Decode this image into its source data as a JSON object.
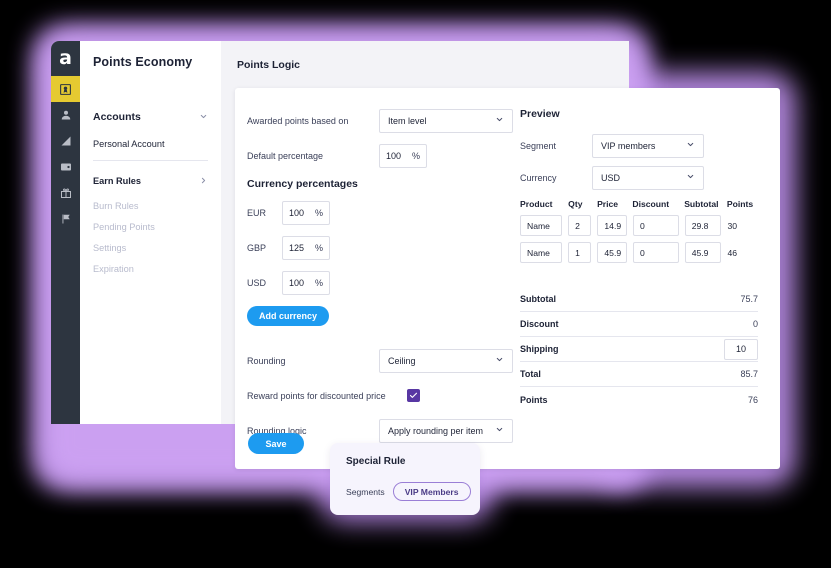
{
  "app": {
    "logo_letter": "a",
    "brand": "Points Economy"
  },
  "rail": {
    "items": [
      {
        "name": "award-badge-icon",
        "active": true
      },
      {
        "name": "user-icon",
        "active": false
      },
      {
        "name": "chart-icon",
        "active": false
      },
      {
        "name": "wallet-icon",
        "active": false
      },
      {
        "name": "gift-icon",
        "active": false
      },
      {
        "name": "flag-icon",
        "active": false
      }
    ]
  },
  "sidebar": {
    "section_label": "Accounts",
    "personal_account": "Personal Account",
    "earn_rules": "Earn Rules",
    "items": [
      {
        "label": "Burn Rules"
      },
      {
        "label": "Pending Points"
      },
      {
        "label": "Settings"
      },
      {
        "label": "Expiration"
      }
    ]
  },
  "header": {
    "title": "Points Logic"
  },
  "form": {
    "awarded_label": "Awarded points based on",
    "awarded_value": "Item level",
    "default_pct_label": "Default percentage",
    "default_pct_value": "100",
    "percent_symbol": "%",
    "currency_heading": "Currency percentages",
    "currencies": [
      {
        "code": "EUR",
        "value": "100"
      },
      {
        "code": "GBP",
        "value": "125"
      },
      {
        "code": "USD",
        "value": "100"
      }
    ],
    "add_currency_label": "Add currency",
    "rounding_label": "Rounding",
    "rounding_value": "Ceiling",
    "reward_discount_label": "Reward points for discounted price",
    "reward_discount_checked": true,
    "rounding_logic_label": "Rounding logic",
    "rounding_logic_value": "Apply rounding per item",
    "save_label": "Save"
  },
  "preview": {
    "title": "Preview",
    "segment_label": "Segment",
    "segment_value": "VIP members",
    "currency_label": "Currency",
    "currency_value": "USD",
    "columns": [
      "Product",
      "Qty",
      "Price",
      "Discount",
      "Subtotal",
      "Points"
    ],
    "rows": [
      {
        "product": "Name",
        "qty": "2",
        "price": "14.9",
        "discount": "0",
        "subtotal": "29.8",
        "points": "30"
      },
      {
        "product": "Name",
        "qty": "1",
        "price": "45.9",
        "discount": "0",
        "subtotal": "45.9",
        "points": "46"
      }
    ],
    "summary": [
      {
        "key": "Subtotal",
        "value": "75.7",
        "input": false
      },
      {
        "key": "Discount",
        "value": "0",
        "input": false
      },
      {
        "key": "Shipping",
        "value": "10",
        "input": true
      },
      {
        "key": "Total",
        "value": "85.7",
        "input": false
      },
      {
        "key": "Points",
        "value": "76",
        "input": false
      }
    ]
  },
  "special_rule": {
    "title": "Special Rule",
    "segments_label": "Segments",
    "segment_pill": "VIP Members"
  },
  "colors": {
    "accent_blue": "#1d9bf0",
    "accent_purple": "#5837a3",
    "rail_bg": "#2d3540",
    "rail_active": "#e5ca31",
    "glow": "#bd8fea",
    "text": "#1d2235"
  }
}
